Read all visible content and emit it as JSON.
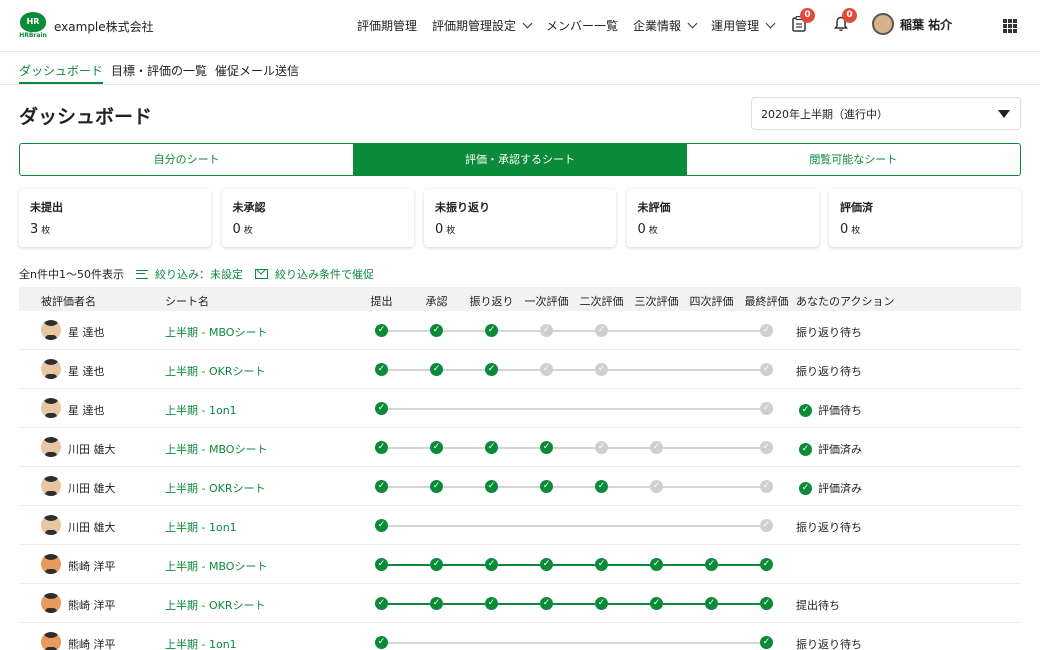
{
  "header": {
    "logo_text": "HR",
    "logo_sub": "HRBrain",
    "company": "example株式会社",
    "nav": [
      {
        "label": "評価期管理",
        "has_menu": false
      },
      {
        "label": "評価期管理設定",
        "has_menu": true
      },
      {
        "label": "メンバー一覧",
        "has_menu": false
      },
      {
        "label": "企業情報",
        "has_menu": true
      },
      {
        "label": "運用管理",
        "has_menu": true
      }
    ],
    "clipboard_badge": "0",
    "bell_badge": "0",
    "user_name": "稲葉 祐介"
  },
  "subnav": {
    "items": [
      "ダッシュボード",
      "目標・評価の一覧",
      "催促メール送信"
    ],
    "active_index": 0
  },
  "page": {
    "title": "ダッシュボード",
    "period": "2020年上半期（進行中）"
  },
  "tabs": {
    "items": [
      "自分のシート",
      "評価・承認するシート",
      "閲覧可能なシート"
    ],
    "active_index": 1
  },
  "stats": [
    {
      "label": "未提出",
      "value": "3",
      "unit": "枚"
    },
    {
      "label": "未承認",
      "value": "0",
      "unit": "枚"
    },
    {
      "label": "未振り返り",
      "value": "0",
      "unit": "枚"
    },
    {
      "label": "未評価",
      "value": "0",
      "unit": "枚"
    },
    {
      "label": "評価済",
      "value": "0",
      "unit": "枚"
    }
  ],
  "filter": {
    "count_text": "全n件中1〜50件表示",
    "filter_label": "絞り込み：未設定",
    "remind_label": "絞り込み条件で催促"
  },
  "table": {
    "headers": {
      "reviewee": "被評価者名",
      "sheet": "シート名",
      "steps": [
        "提出",
        "承認",
        "振り返り",
        "一次評価",
        "二次評価",
        "三次評価",
        "四次評価",
        "最終評価"
      ],
      "action": "あなたのアクション"
    },
    "rows": [
      {
        "name": "星 達也",
        "sheet": "上半期 - MBOシート",
        "steps": [
          "done",
          "done",
          "done",
          "pending",
          "pending",
          "none",
          "none",
          "pending"
        ],
        "action": "振り返り待ち",
        "action_check": false,
        "avatar": "man"
      },
      {
        "name": "星 達也",
        "sheet": "上半期 - OKRシート",
        "steps": [
          "done",
          "done",
          "done",
          "pending",
          "pending",
          "none",
          "none",
          "pending"
        ],
        "action": "振り返り待ち",
        "action_check": false,
        "avatar": "man"
      },
      {
        "name": "星 達也",
        "sheet": "上半期 - 1on1",
        "steps": [
          "done",
          "none",
          "none",
          "none",
          "none",
          "none",
          "none",
          "pending"
        ],
        "action": "評価待ち",
        "action_check": true,
        "avatar": "man"
      },
      {
        "name": "川田 雄大",
        "sheet": "上半期 - MBOシート",
        "steps": [
          "done",
          "done",
          "done",
          "done",
          "pending",
          "pending",
          "none",
          "pending"
        ],
        "action": "評価済み",
        "action_check": true,
        "avatar": "man"
      },
      {
        "name": "川田 雄大",
        "sheet": "上半期 - OKRシート",
        "steps": [
          "done",
          "done",
          "done",
          "done",
          "done",
          "pending",
          "none",
          "pending"
        ],
        "action": "評価済み",
        "action_check": true,
        "avatar": "man"
      },
      {
        "name": "川田 雄大",
        "sheet": "上半期 - 1on1",
        "steps": [
          "done",
          "none",
          "none",
          "none",
          "none",
          "none",
          "none",
          "pending"
        ],
        "action": "振り返り待ち",
        "action_check": false,
        "avatar": "man"
      },
      {
        "name": "熊崎 洋平",
        "sheet": "上半期 - MBOシート",
        "steps": [
          "done",
          "done",
          "done",
          "done",
          "done",
          "done",
          "done",
          "done"
        ],
        "action": "",
        "action_check": false,
        "avatar": "orange"
      },
      {
        "name": "熊崎 洋平",
        "sheet": "上半期 - OKRシート",
        "steps": [
          "done",
          "done",
          "done",
          "done",
          "done",
          "done",
          "done",
          "done"
        ],
        "action": "提出待ち",
        "action_check": false,
        "avatar": "orange"
      },
      {
        "name": "熊崎 洋平",
        "sheet": "上半期 - 1on1",
        "steps": [
          "done",
          "none",
          "none",
          "none",
          "none",
          "none",
          "none",
          "done"
        ],
        "action": "振り返り待ち",
        "action_check": false,
        "avatar": "orange"
      }
    ]
  },
  "colors": {
    "brand": "#0b8a3a",
    "badge": "#e04b3c",
    "pending": "#cfcfcf"
  }
}
